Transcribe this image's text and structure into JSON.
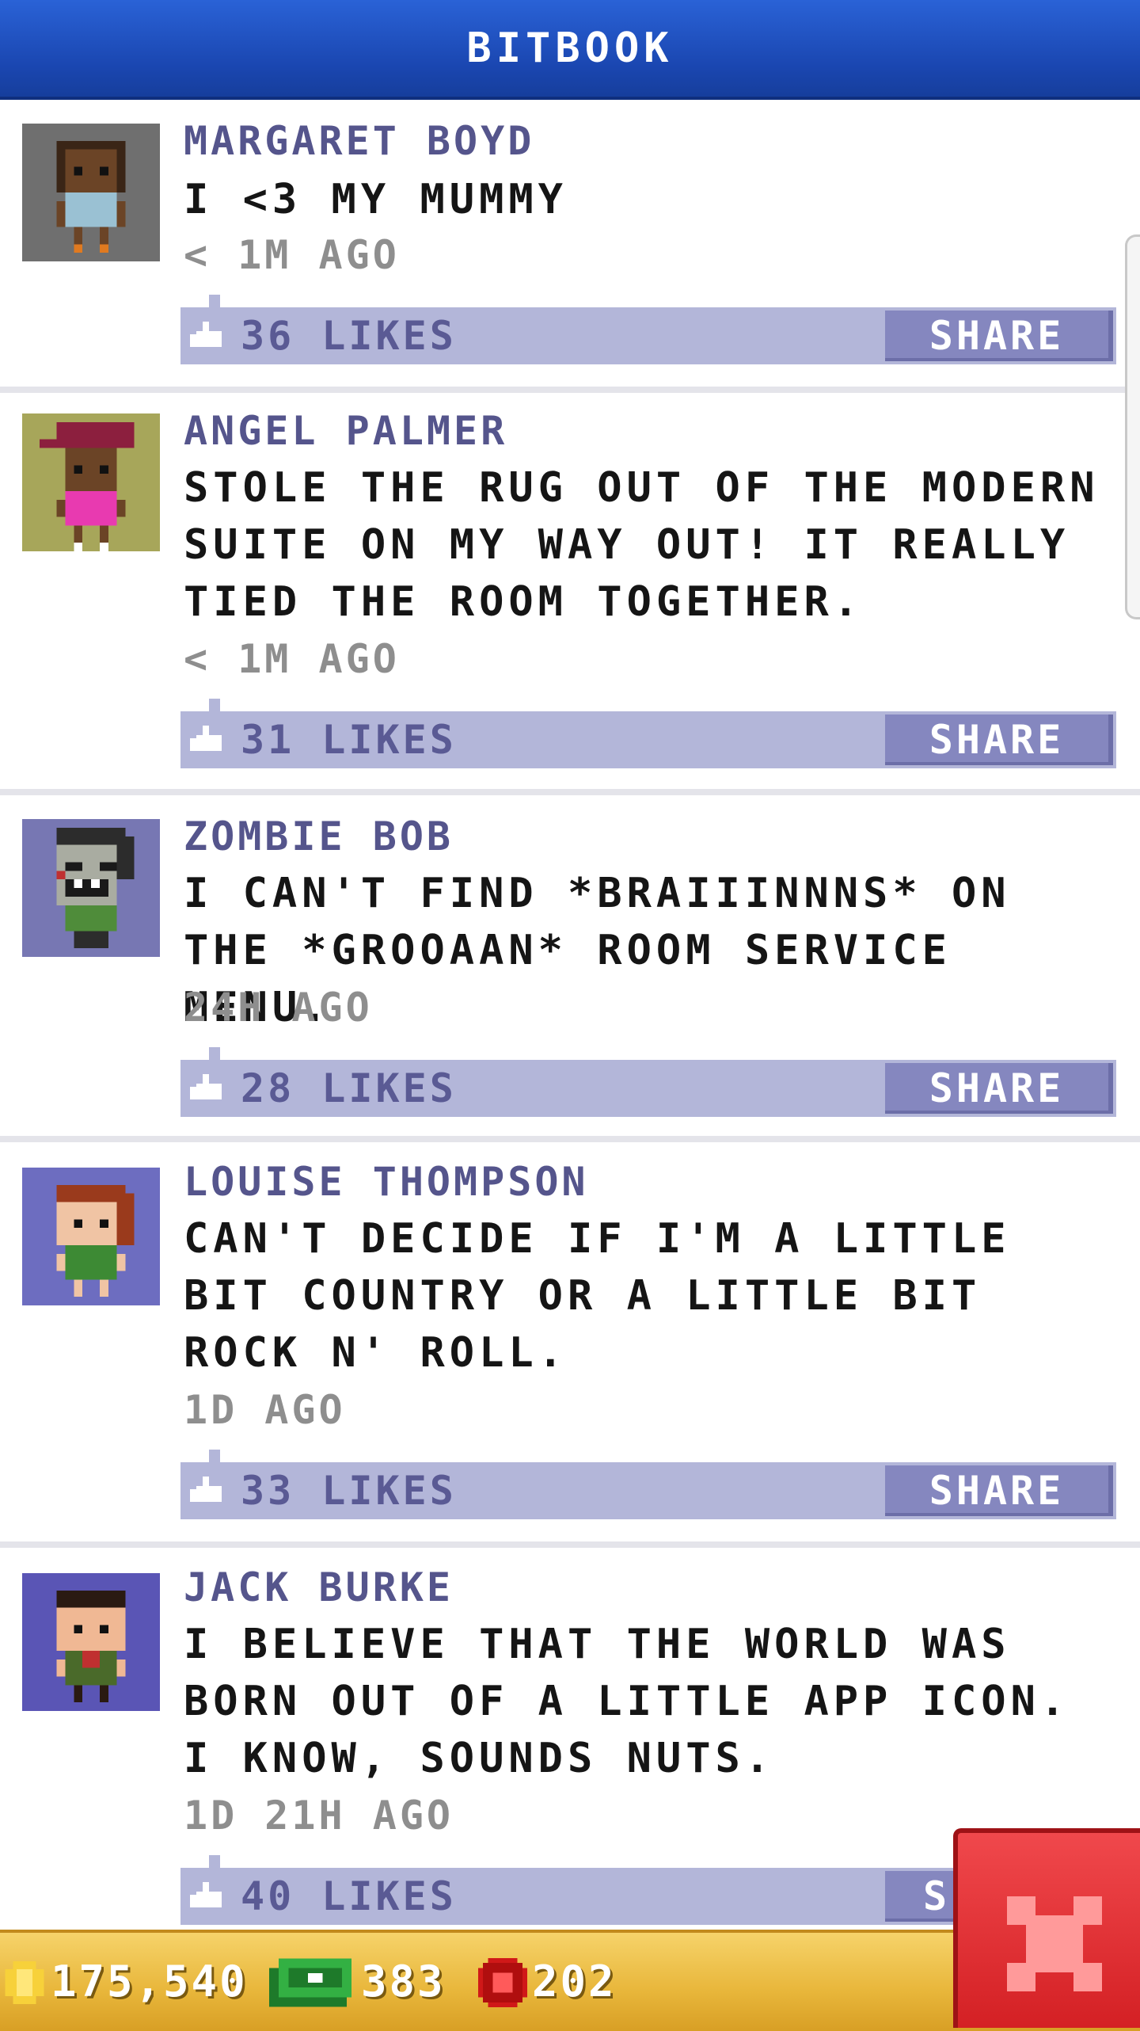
{
  "app": {
    "title": "BITBOOK"
  },
  "posts": [
    {
      "author": "MARGARET BOYD",
      "message": "I <3 MY MUMMY",
      "time": "< 1M AGO",
      "likes": "36 LIKES",
      "share_label": "SHARE",
      "avatar_bg": "#6f6f6f"
    },
    {
      "author": "ANGEL PALMER",
      "message": "STOLE THE RUG OUT OF THE MODERN SUITE ON MY WAY OUT! IT REALLY TIED THE ROOM TOGETHER.",
      "time": "< 1M AGO",
      "likes": "31 LIKES",
      "share_label": "SHARE",
      "avatar_bg": "#a7a65a"
    },
    {
      "author": "ZOMBIE BOB",
      "message": "I CAN'T FIND *BRAIIINNNS* ON THE *GROOAAN* ROOM SERVICE MENU.",
      "time": "24H AGO",
      "likes": "28 LIKES",
      "share_label": "SHARE",
      "avatar_bg": "#7777b3"
    },
    {
      "author": "LOUISE THOMPSON",
      "message": "CAN'T DECIDE IF I'M A LITTLE BIT COUNTRY OR A LITTLE BIT ROCK N' ROLL.",
      "time": "1D AGO",
      "likes": "33 LIKES",
      "share_label": "SHARE",
      "avatar_bg": "#6d6dc0"
    },
    {
      "author": "JACK BURKE",
      "message": "I BELIEVE THAT THE WORLD WAS BORN OUT OF A LITTLE APP ICON. I KNOW, SOUNDS NUTS.",
      "time": "1D 21H AGO",
      "likes": "40 LIKES",
      "share_label": "S",
      "avatar_bg": "#5a55b5"
    }
  ],
  "footer": {
    "coins": "175,540",
    "cash": "383",
    "bux": "202"
  },
  "colors": {
    "header": "#1a46b0",
    "accent": "#55558c",
    "likebar": "#b3b6d9",
    "share": "#8587bf",
    "footer": "#e8b63a",
    "close": "#d42024"
  },
  "icons": {
    "coin": "coin-icon",
    "cash": "cash-icon",
    "bux": "bux-icon",
    "like": "thumbs-up-icon",
    "close": "close-icon"
  }
}
